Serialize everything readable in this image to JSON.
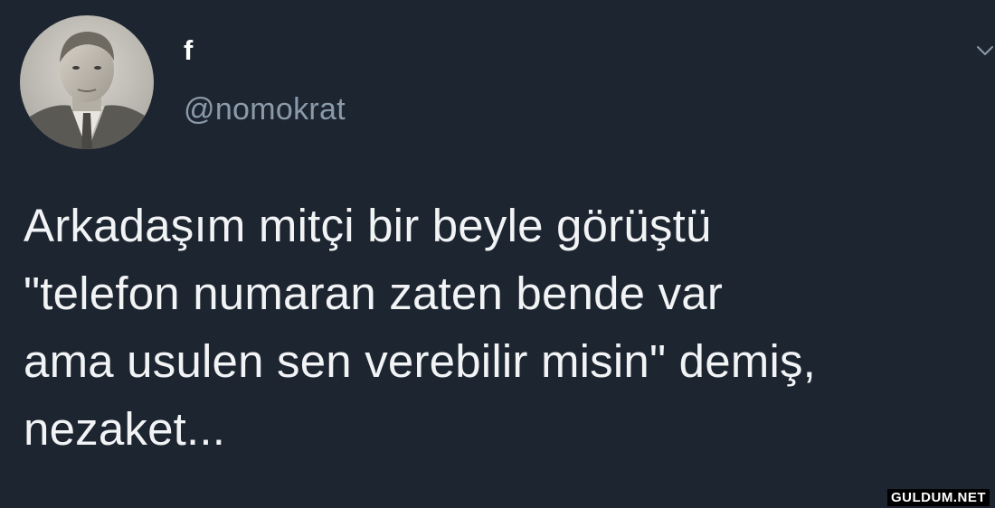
{
  "tweet": {
    "display_name": "f",
    "handle": "@nomokrat",
    "text": "Arkadaşım mitçi bir beyle görüştü\n\"telefon numaran zaten bende var\nama usulen sen verebilir misin\" demiş,\nnezaket...",
    "menu_icon": "chevron-down-icon",
    "avatar_icon": "avatar-photo"
  },
  "watermark": "GULDUM.NET",
  "colors": {
    "background": "#1d2531",
    "text": "#f1f3f5",
    "handle": "#8a9aa9"
  }
}
